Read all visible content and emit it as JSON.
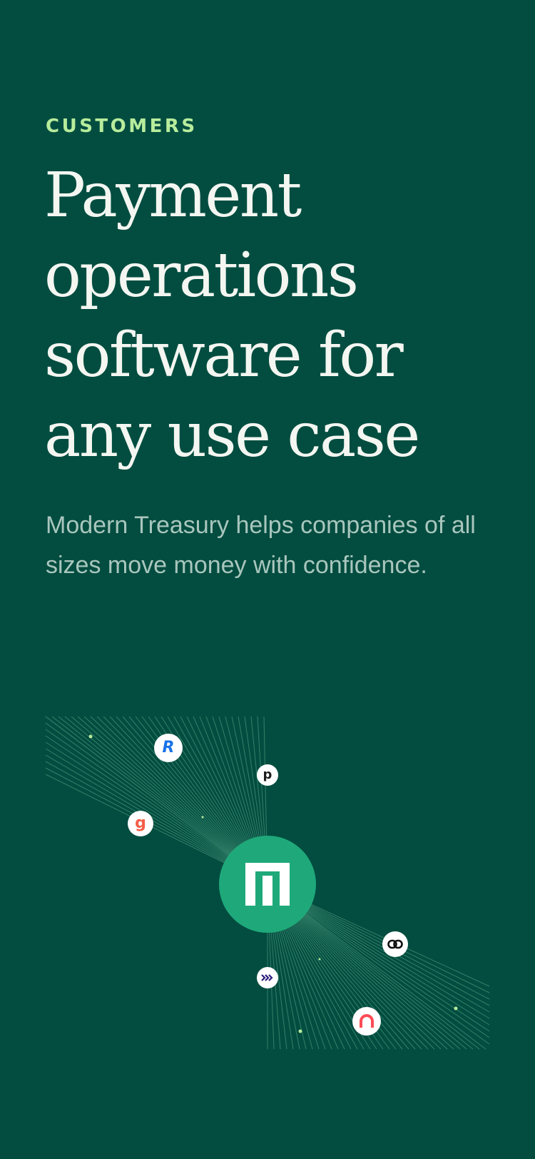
{
  "hero": {
    "eyebrow": "CUSTOMERS",
    "headline": "Payment operations software for any use case",
    "subtext": "Modern Treasury helps companies of all sizes move money with confidence."
  },
  "graphic": {
    "hub_icon": "modern-treasury-logo-icon",
    "customer_logos": [
      {
        "name": "revolut-logo-icon",
        "glyph": "R",
        "color": "#1a73e8"
      },
      {
        "name": "pipe-logo-icon",
        "glyph": "p",
        "color": "#1c1c1c"
      },
      {
        "name": "gusto-logo-icon",
        "glyph": "g",
        "color": "#f45d48"
      },
      {
        "name": "chain-link-logo-icon",
        "glyph": "",
        "color": "#111111"
      },
      {
        "name": "arrows-logo-icon",
        "glyph": "",
        "color": "#2b1d7a"
      },
      {
        "name": "arch-logo-icon",
        "glyph": "",
        "color": "#ff4b55"
      }
    ],
    "colors": {
      "background": "#024d40",
      "hub": "#1fa97a",
      "rays": "#6fbf9a",
      "dots": "#b8ec9c"
    }
  }
}
